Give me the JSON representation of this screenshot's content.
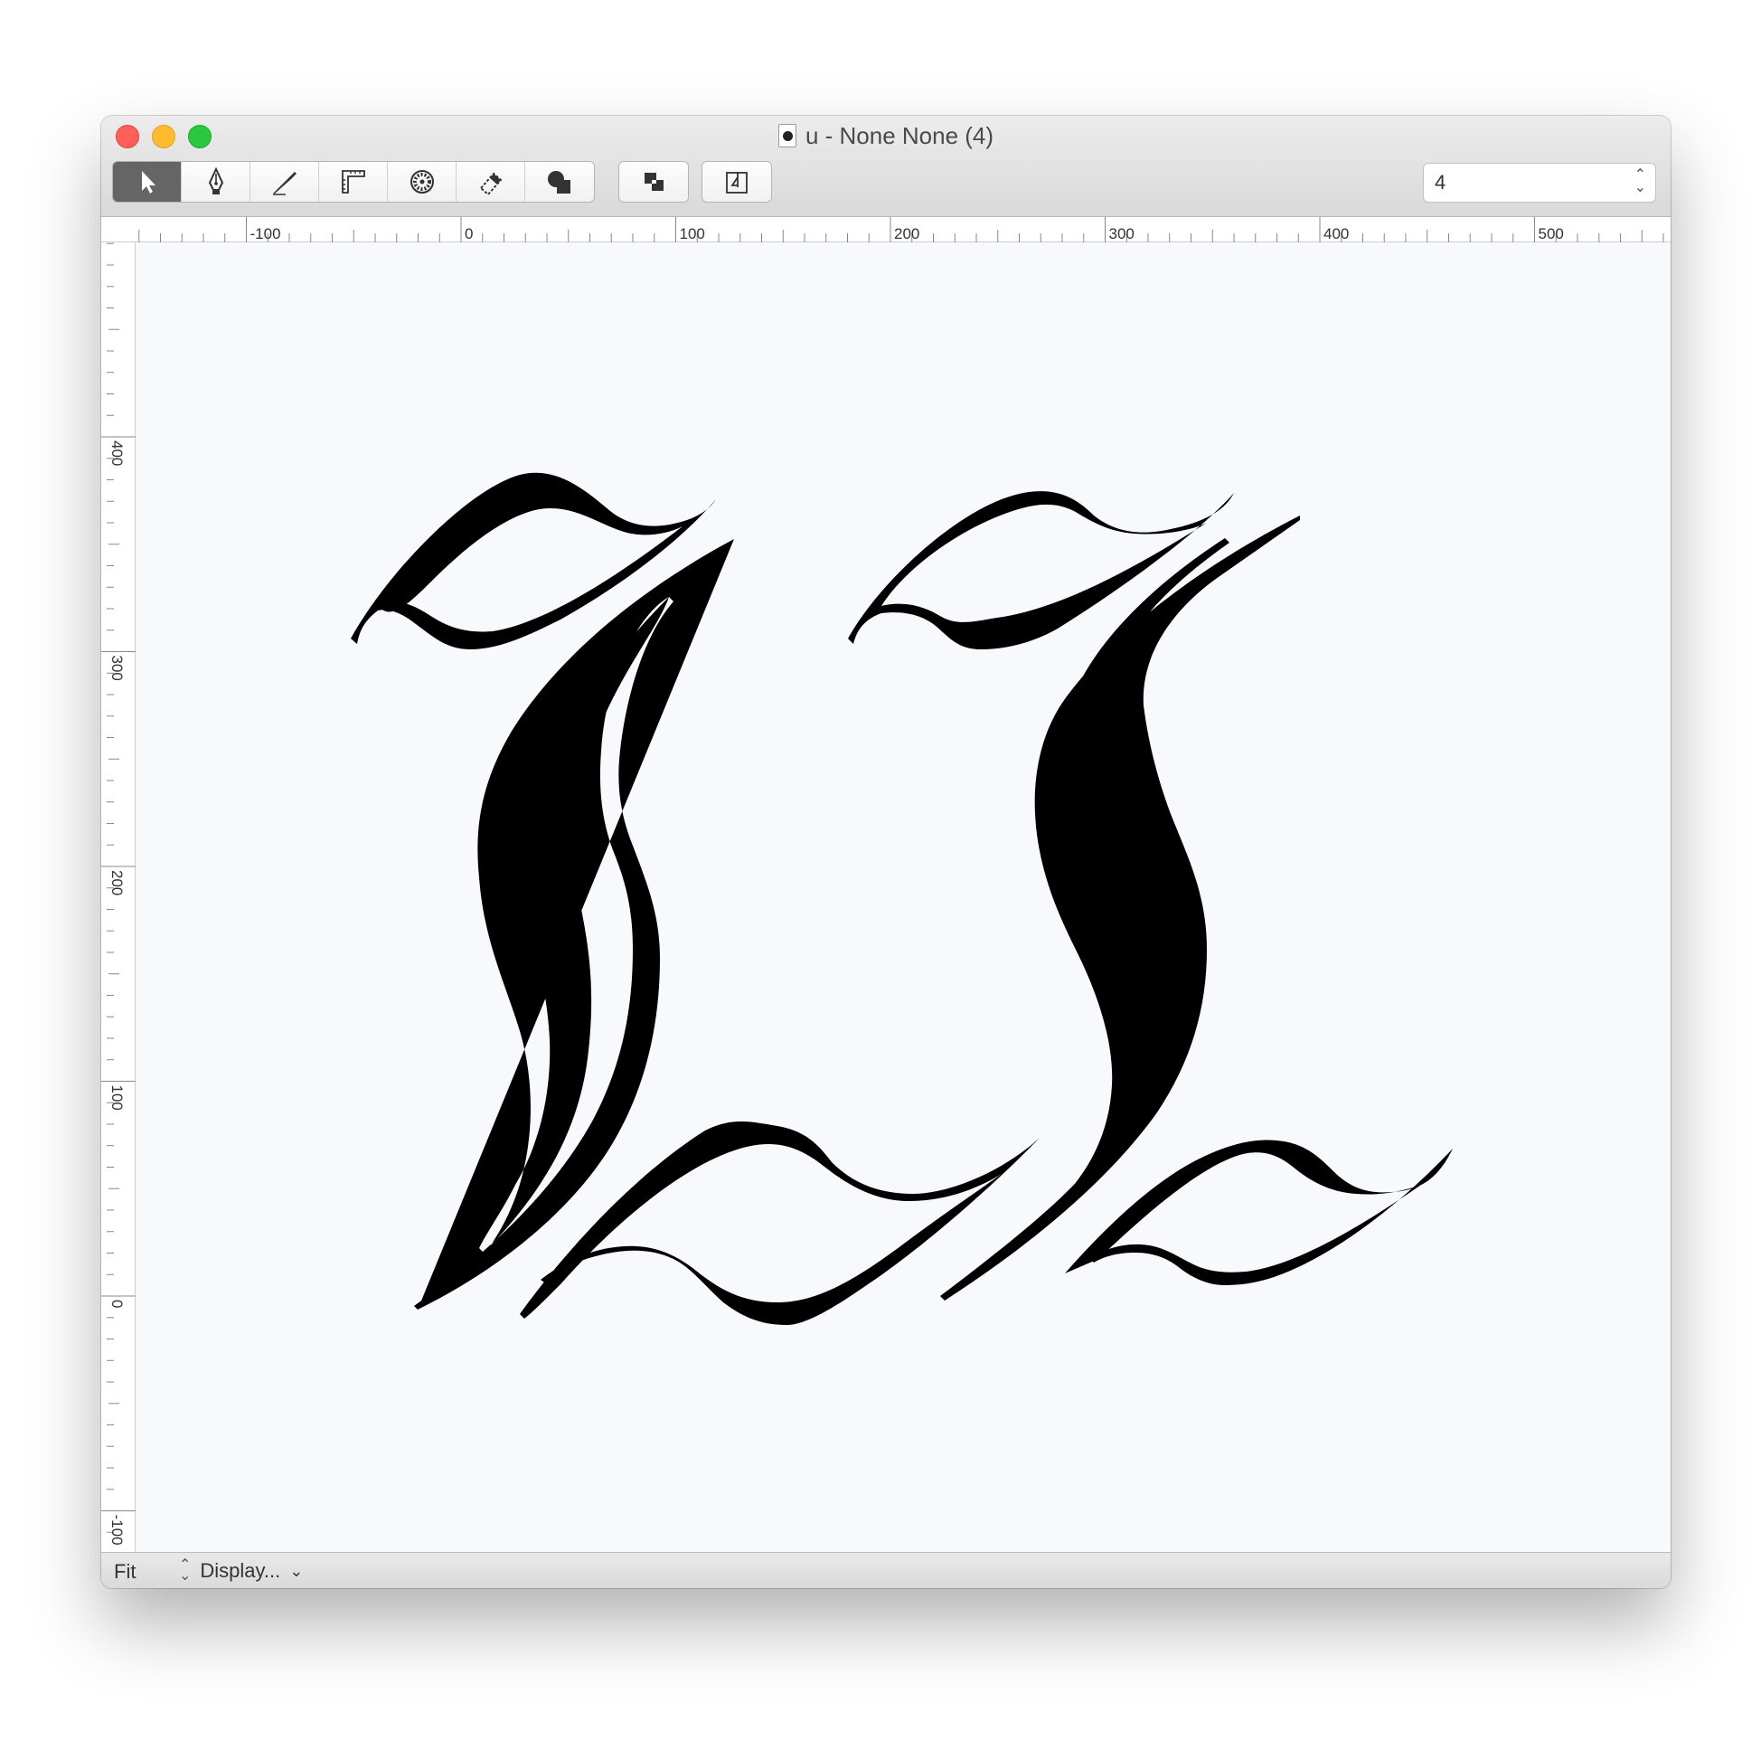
{
  "window": {
    "title": "u - None None (4)"
  },
  "toolbar": {
    "tools": [
      {
        "name": "select-tool",
        "icon": "arrow-pointer-icon",
        "active": true
      },
      {
        "name": "pen-tool",
        "icon": "fountain-pen-icon",
        "active": false
      },
      {
        "name": "knife-tool",
        "icon": "knife-icon",
        "active": false
      },
      {
        "name": "measure-tool",
        "icon": "ruler-corner-icon",
        "active": false
      },
      {
        "name": "tunni-tool",
        "icon": "dotted-circle-icon",
        "active": false
      },
      {
        "name": "eraser-tool",
        "icon": "eraser-icon",
        "active": false
      },
      {
        "name": "shapes-tool",
        "icon": "shapes-icon",
        "active": false
      }
    ],
    "overlap_icon": "overlap-squares-icon",
    "export_icon": "glyph-export-icon"
  },
  "page_selector": {
    "value": "4"
  },
  "rulers": {
    "horizontal_labels": [
      "-100",
      "0",
      "100",
      "200",
      "300",
      "400",
      "500"
    ],
    "vertical_labels": [
      "400",
      "300",
      "200",
      "100",
      "0",
      "-100"
    ]
  },
  "statusbar": {
    "zoom_label": "Fit",
    "display_label": "Display..."
  },
  "colors": {
    "glyph_fill": "#000000",
    "canvas_bg": "#f8f9fc",
    "active_tool": "#656565",
    "close": "#fe5f57",
    "minimize": "#febc2e",
    "maximize": "#28c840"
  }
}
